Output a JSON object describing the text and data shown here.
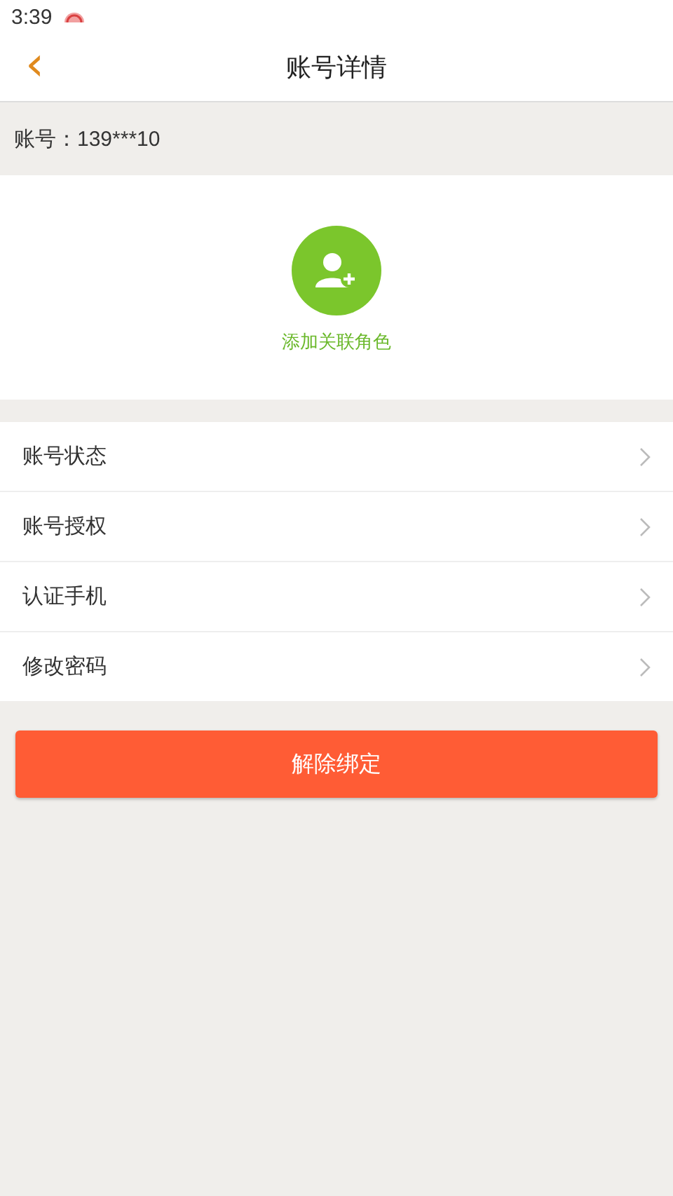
{
  "status_bar": {
    "time": "3:39"
  },
  "header": {
    "back": "‹",
    "title": "账号详情"
  },
  "account": {
    "text": "账号：139***10"
  },
  "add_role": {
    "label": "添加关联角色"
  },
  "menu": [
    {
      "label": "账号状态"
    },
    {
      "label": "账号授权"
    },
    {
      "label": "认证手机"
    },
    {
      "label": "修改密码"
    }
  ],
  "unbind_button": "解除绑定"
}
